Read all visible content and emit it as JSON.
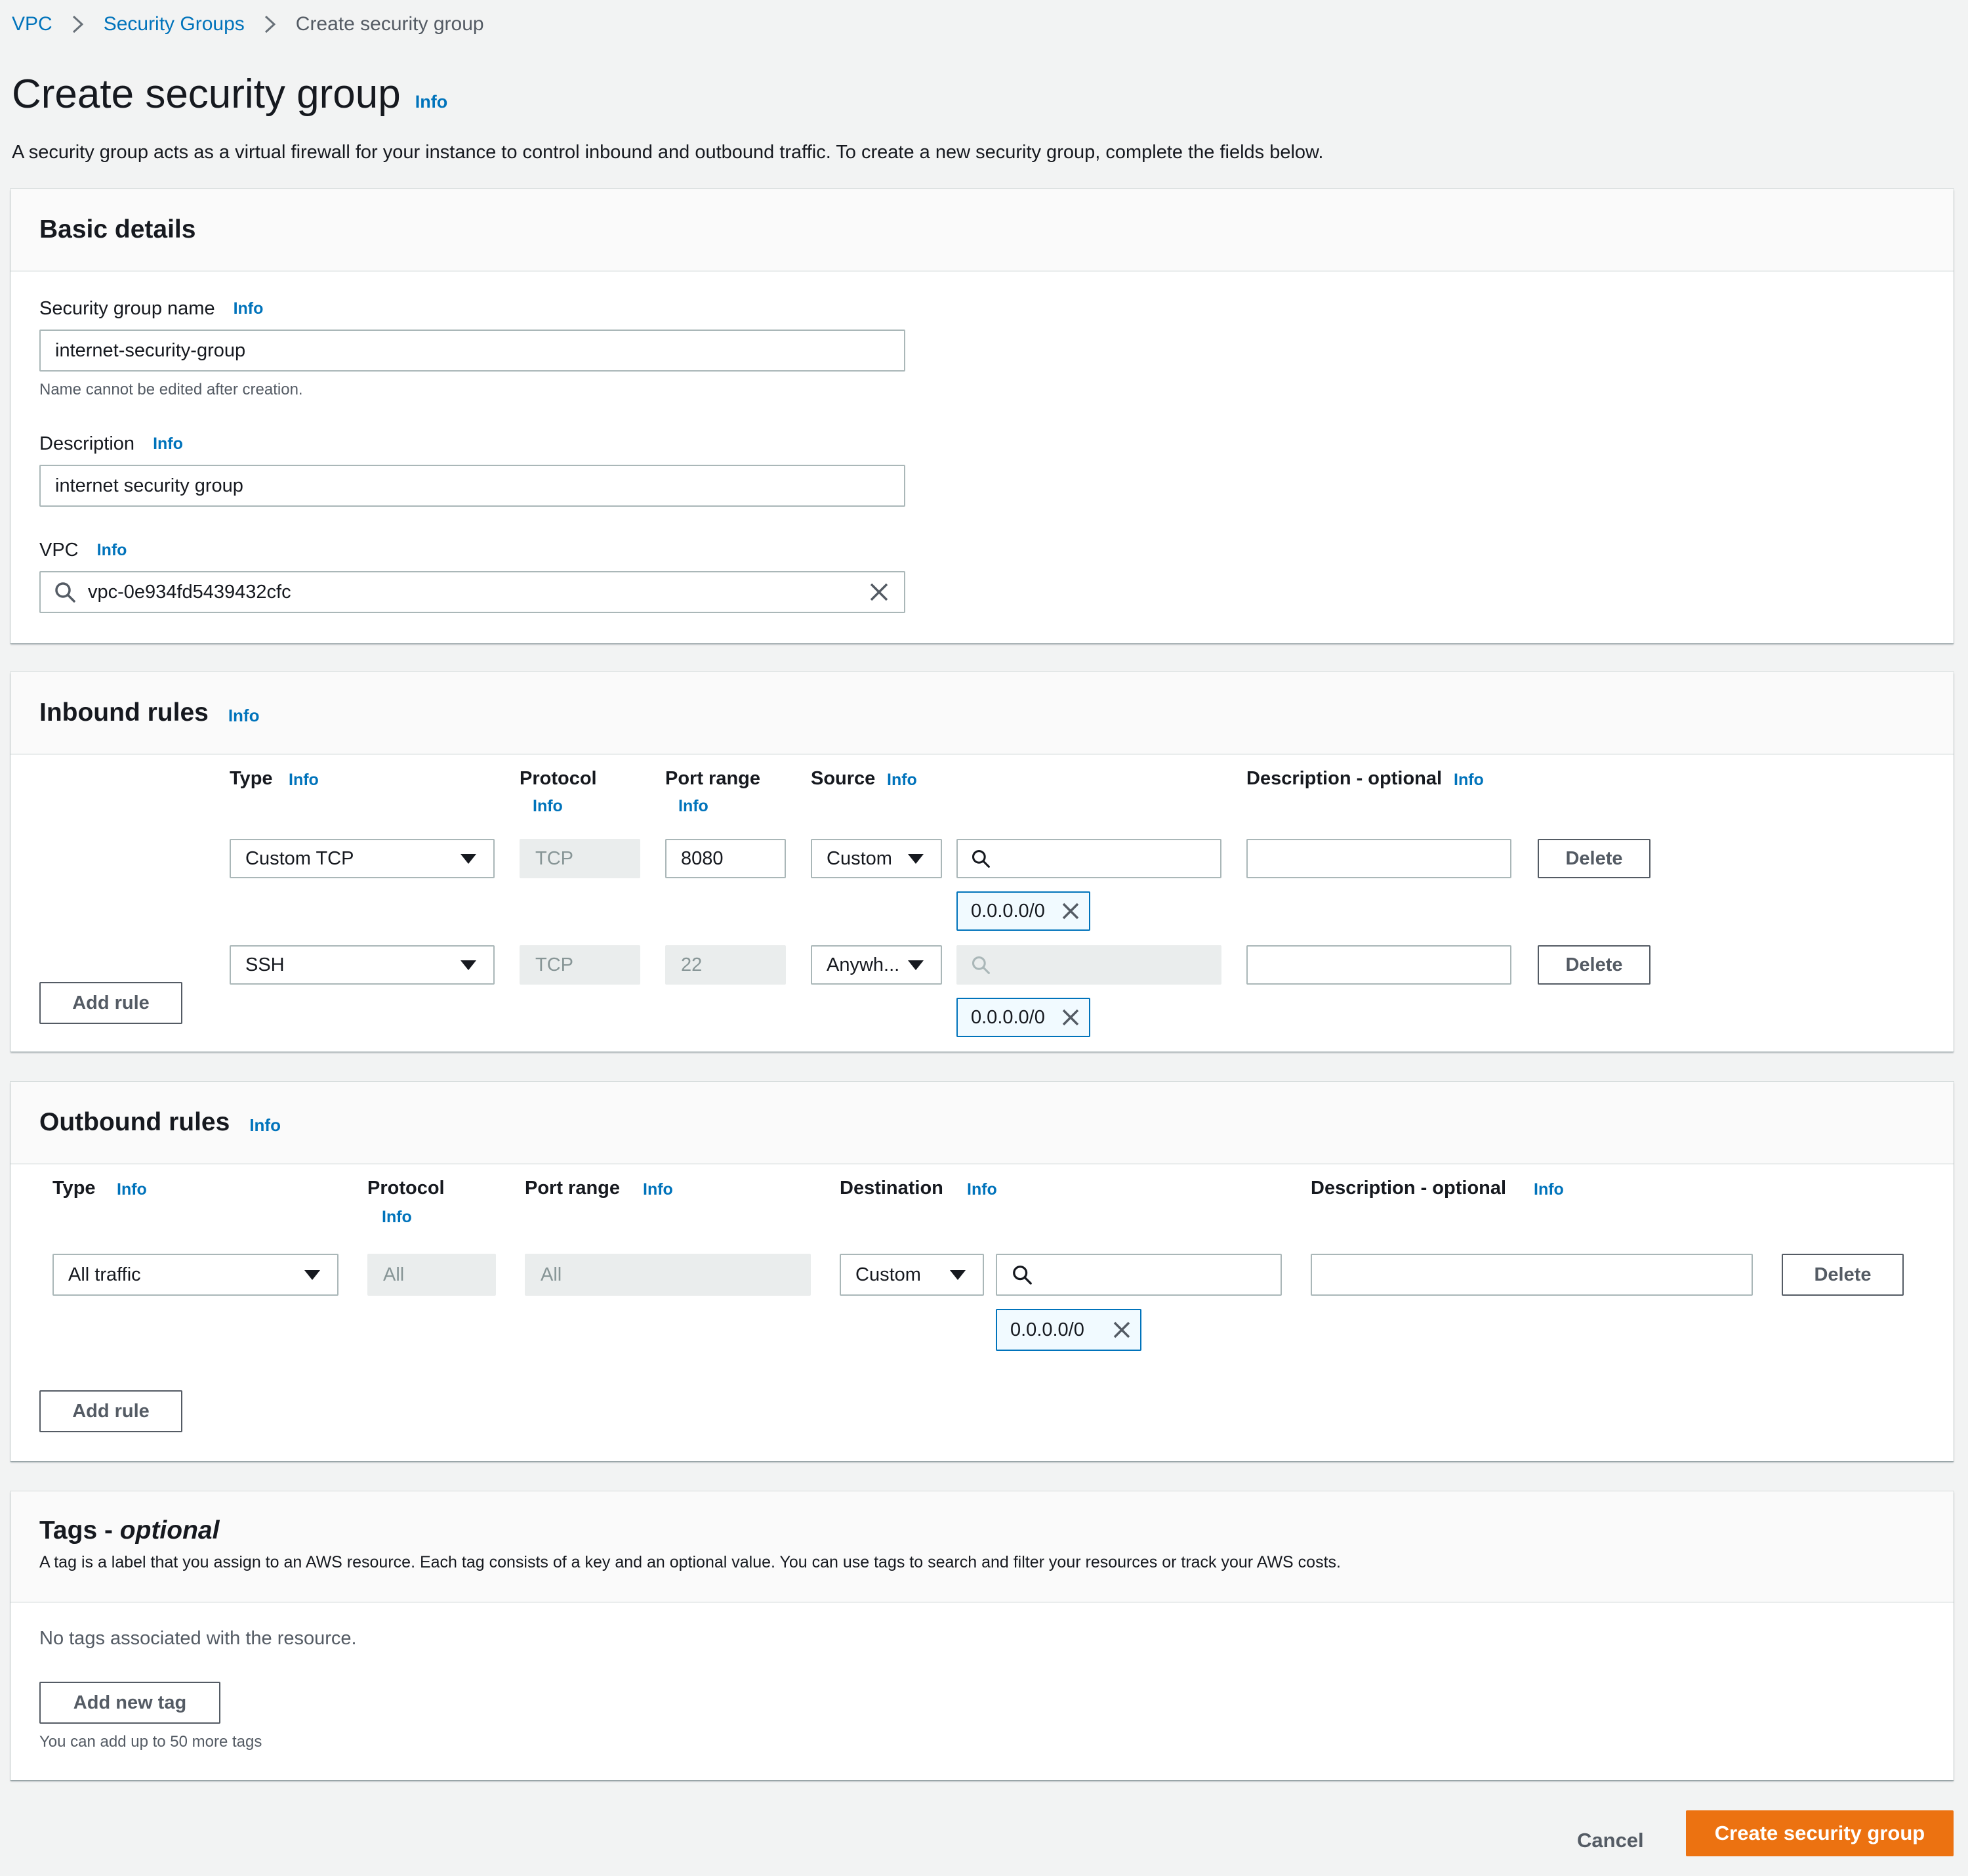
{
  "breadcrumb": {
    "items": [
      "VPC",
      "Security Groups"
    ],
    "current": "Create security group"
  },
  "page": {
    "title": "Create security group",
    "info": "Info",
    "description": "A security group acts as a virtual firewall for your instance to control inbound and outbound traffic. To create a new security group, complete the fields below."
  },
  "basic": {
    "heading": "Basic details",
    "name_label": "Security group name",
    "name_value": "internet-security-group",
    "name_hint": "Name cannot be edited after creation.",
    "desc_label": "Description",
    "desc_value": "internet security group",
    "vpc_label": "VPC",
    "vpc_value": "vpc-0e934fd5439432cfc",
    "info": "Info"
  },
  "inbound": {
    "heading": "Inbound rules",
    "info": "Info",
    "columns": {
      "type": "Type",
      "protocol": "Protocol",
      "port_range": "Port range",
      "source": "Source",
      "description": "Description - optional"
    },
    "rules": [
      {
        "type": "Custom TCP",
        "protocol": "TCP",
        "port": "8080",
        "source": "Custom",
        "cidr": "0.0.0.0/0",
        "description": ""
      },
      {
        "type": "SSH",
        "protocol": "TCP",
        "port": "22",
        "source": "Anywh...",
        "cidr": "0.0.0.0/0",
        "description": ""
      }
    ],
    "delete_label": "Delete",
    "add_rule": "Add rule"
  },
  "outbound": {
    "heading": "Outbound rules",
    "info": "Info",
    "columns": {
      "type": "Type",
      "protocol": "Protocol",
      "port_range": "Port range",
      "destination": "Destination",
      "description": "Description - optional"
    },
    "rules": [
      {
        "type": "All traffic",
        "protocol": "All",
        "port": "All",
        "destination": "Custom",
        "cidr": "0.0.0.0/0",
        "description": ""
      }
    ],
    "delete_label": "Delete",
    "add_rule": "Add rule"
  },
  "tags": {
    "heading": "Tags - ",
    "heading_optional": "optional",
    "description": "A tag is a label that you assign to an AWS resource. Each tag consists of a key and an optional value. You can use tags to search and filter your resources or track your AWS costs.",
    "empty": "No tags associated with the resource.",
    "add_tag": "Add new tag",
    "limit_hint": "You can add up to 50 more tags"
  },
  "footer": {
    "cancel": "Cancel",
    "create": "Create security group"
  },
  "colors": {
    "link": "#0073bb",
    "primary": "#ec7211",
    "background": "#f2f3f3"
  }
}
